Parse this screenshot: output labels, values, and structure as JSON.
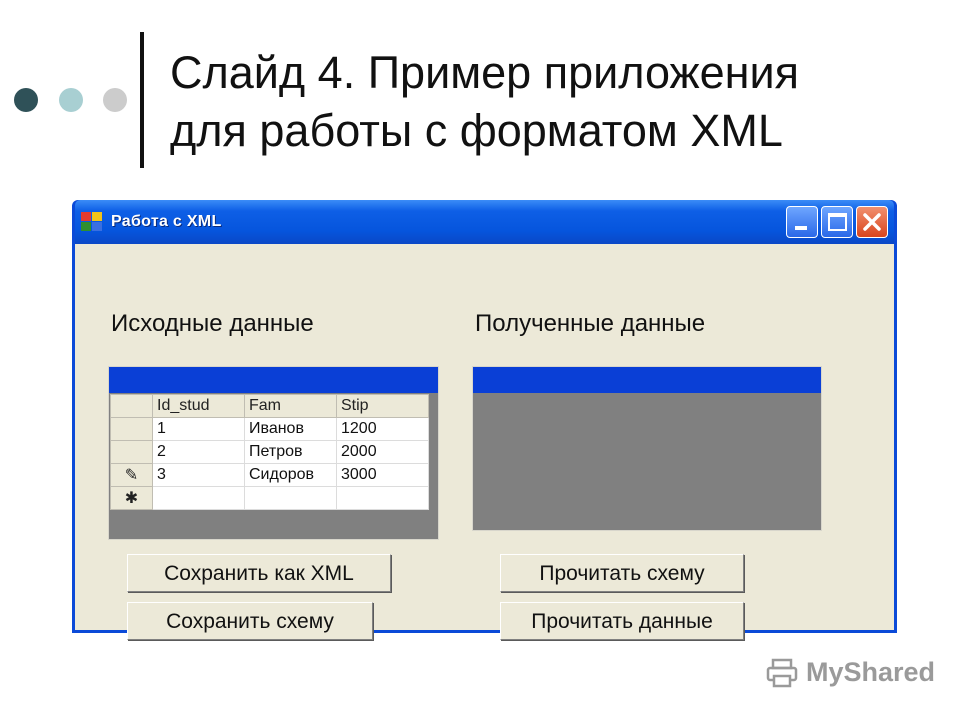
{
  "slide": {
    "title": "Слайд 4. Пример приложения\nдля работы с форматом XML"
  },
  "window": {
    "title": "Работа с XML",
    "controls": {
      "minimize_icon": "minimize-icon",
      "maximize_icon": "maximize-icon",
      "close_icon": "close-icon"
    }
  },
  "source_section": {
    "label": "Исходные данные",
    "columns": [
      "Id_stud",
      "Fam",
      "Stip"
    ],
    "rows": [
      {
        "indicator": "",
        "cells": [
          "1",
          "Иванов",
          "1200"
        ]
      },
      {
        "indicator": "",
        "cells": [
          "2",
          "Петров",
          "2000"
        ]
      },
      {
        "indicator": "✎",
        "cells": [
          "3",
          "Сидоров",
          "3000"
        ]
      },
      {
        "indicator": "✱",
        "cells": [
          "",
          "",
          ""
        ]
      }
    ]
  },
  "result_section": {
    "label": "Полученные данные"
  },
  "buttons": {
    "save_xml": "Сохранить как XML",
    "save_schema": "Сохранить схему",
    "read_schema": "Прочитать схему",
    "read_data": "Прочитать данные"
  },
  "watermark": {
    "text": "MyShared",
    "icon": "printer-logo-icon"
  },
  "colors": {
    "titlebar": "#0655dd",
    "grid_caption": "#0a3fd6",
    "window_bg": "#ece9d8",
    "grid_empty": "#808080",
    "close_button": "#d9441d"
  }
}
